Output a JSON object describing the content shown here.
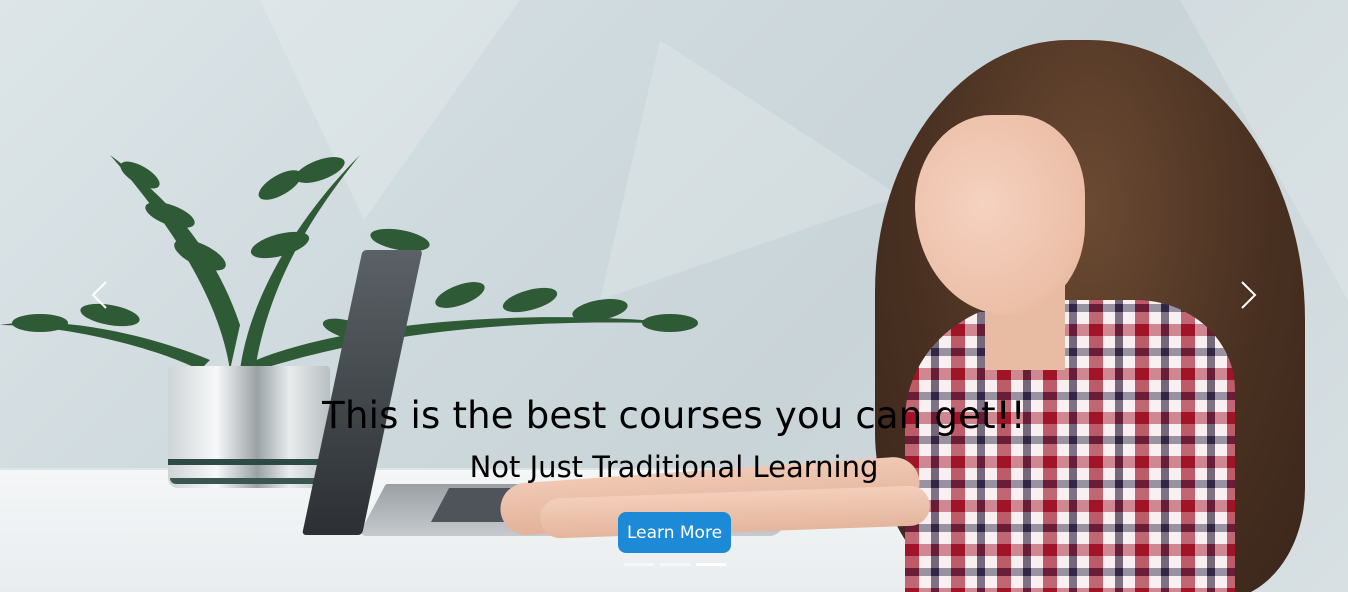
{
  "hero": {
    "headline": "This is the best courses you can get!!",
    "subheadline": "Not Just Traditional Learning",
    "cta_label": "Learn More"
  },
  "controls": {
    "prev_icon": "chevron-left-icon",
    "next_icon": "chevron-right-icon"
  },
  "indicators": {
    "count": 3,
    "active_index": 2
  },
  "colors": {
    "accent": "#1c8ad6",
    "text": "#000000",
    "indicator_active": "#ffffff"
  }
}
